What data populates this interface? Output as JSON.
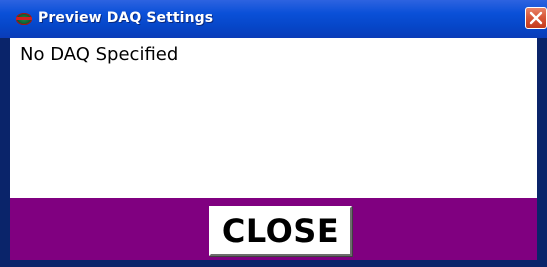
{
  "window": {
    "title": "Preview DAQ Settings",
    "app_icon": "app-logo-icon",
    "close_icon": "close-icon"
  },
  "content": {
    "message": "No DAQ Specified"
  },
  "footer": {
    "close_label": "CLOSE"
  },
  "colors": {
    "titlebar": "#0a50d8",
    "footer_background": "#800080",
    "content_background": "#ffffff",
    "window_frame": "#0a246a",
    "close_x_button": "#d8583a"
  }
}
